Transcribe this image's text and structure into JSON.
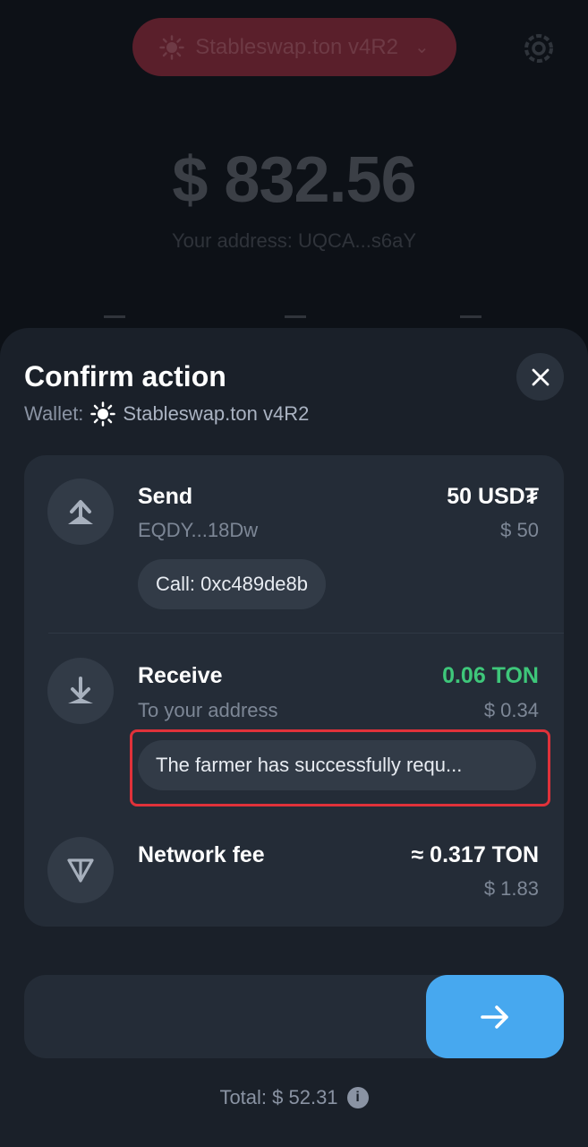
{
  "background": {
    "wallet_selector": {
      "name": "Stableswap.ton v4R2",
      "icon": "sun-icon"
    },
    "settings_icon": "gear-icon",
    "balance": "$ 832.56",
    "address": "Your address: UQCA...s6aY"
  },
  "sheet": {
    "title": "Confirm action",
    "wallet_label": "Wallet:",
    "wallet_name": "Stableswap.ton v4R2",
    "close_icon": "close-icon",
    "rows": [
      {
        "title": "Send",
        "subtitle": "EQDY...18Dw",
        "amount": "50 USD₮",
        "usd": "$ 50",
        "chip": "Call: 0xc489de8b",
        "icon": "arrow-up-icon"
      },
      {
        "title": "Receive",
        "subtitle": "To your address",
        "amount": "0.06 TON",
        "usd": "$ 0.34",
        "chip": "The farmer has successfully requ...",
        "icon": "arrow-down-icon"
      },
      {
        "title": "Network fee",
        "amount": "≈ 0.317 TON",
        "usd": "$ 1.83",
        "icon": "ton-icon"
      }
    ],
    "total": "Total: $ 52.31",
    "colors": {
      "accent": "#47a8ef",
      "positive": "#3ec77a",
      "highlight": "#e0323a"
    }
  }
}
